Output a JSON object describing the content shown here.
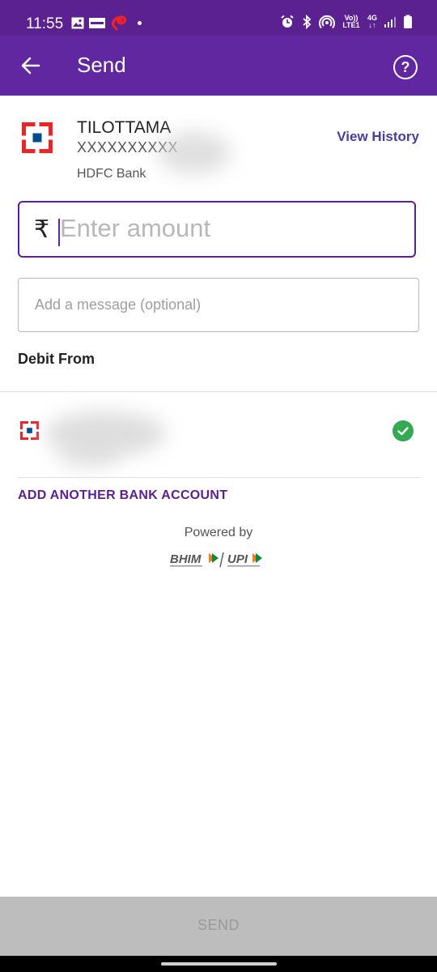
{
  "status_bar": {
    "time": "11:55",
    "network_label": "Vo)) LTE1",
    "network_type": "4G",
    "icons": [
      "image-icon",
      "rcs-icon",
      "airtel-icon",
      "dot-icon",
      "alarm-icon",
      "bluetooth-icon",
      "hotspot-icon",
      "signal-icon",
      "battery-icon"
    ]
  },
  "app_bar": {
    "title": "Send",
    "back_icon": "arrow-left-icon",
    "help_icon": "help-circle-icon",
    "background": "#6027a1"
  },
  "payee": {
    "name": "TILOTTAMA",
    "account": "XXXXXXXXXX",
    "bank": "HDFC Bank",
    "view_history_label": "View History"
  },
  "amount": {
    "currency_symbol": "₹",
    "placeholder": "Enter amount"
  },
  "message": {
    "placeholder": "Add a message (optional)"
  },
  "debit": {
    "heading": "Debit From",
    "selected_icon": "check-circle-icon",
    "add_account_label": "ADD ANOTHER BANK ACCOUNT"
  },
  "footer": {
    "powered_by": "Powered by",
    "bhim": "BHIM",
    "upi": "UPI",
    "send_label": "SEND"
  },
  "colors": {
    "accent": "#6027a1",
    "hdfc_red": "#ed232a",
    "hdfc_blue": "#004c8f",
    "success_green": "#34a853"
  }
}
